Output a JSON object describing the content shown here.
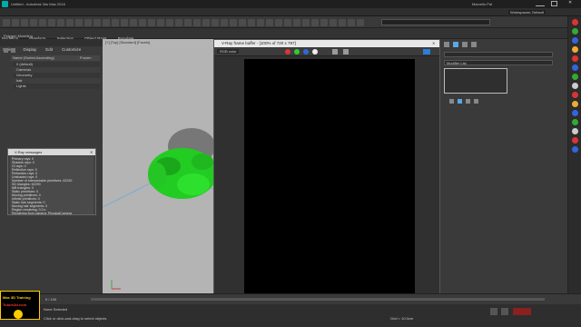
{
  "window": {
    "title": "Untitled - Autodesk 3ds Max 2016",
    "user": "Marcello Pal",
    "workspace": "Workspaces: Default"
  },
  "menu": [
    "File",
    "Edit",
    "Tools",
    "Group",
    "Views",
    "Create",
    "Modifiers",
    "Animation",
    "Graph Editors",
    "Rendering",
    "Civil View",
    "Customize",
    "Scripting",
    "Interactive",
    "Content",
    "Help",
    "Arnold",
    "Substance"
  ],
  "ribbon": {
    "tabs": [
      "Modeling",
      "Freeform",
      "Selection",
      "Object Paint",
      "Populate"
    ],
    "subtitle": "Polygon Modeling"
  },
  "explorer": {
    "tabs": [
      "Select",
      "Display",
      "Edit",
      "Customize"
    ],
    "header": "Name (Sorted Ascending)",
    "col2": "Frozen",
    "rows": [
      "0 (default)",
      "Cameras",
      "Geometry",
      "hair",
      "Lights"
    ]
  },
  "viewport": {
    "label": "[+] [Top] [Standard] [Facets]"
  },
  "framebuffer": {
    "title": "V-Ray frame buffer - [100% of 720 x 797]",
    "channel": "RGB color",
    "status": "Merging light cache passes... done [00:00:01.2]"
  },
  "vray_messages": {
    "title": "V-Ray messages",
    "lines": [
      "Primary rays: 0",
      "Shadow rays: 0",
      "GI rays: 0",
      "Reflection rays: 0",
      "Refraction rays: 0",
      "Unshaded rays: 0",
      "Number of intersectable primitives: 62290",
      "SD triangles: 62290",
      "MB triangles: 0",
      "Static primitives: 0",
      "Moving primitives: 0",
      "Infinite primitives: 0",
      "Static hair segments: 0",
      "Moving hair segments: 0",
      "Region rendering: 0.0 s",
      "Rendering from camera: PhysicalCamera"
    ]
  },
  "modifier": {
    "label": "Modifier List"
  },
  "status": {
    "selection": "None Selected",
    "hint": "Click or click-and-drag to select objects",
    "grid": "Grid = 10.0cm",
    "frame": "0 / 100"
  },
  "logo": {
    "line1": "Max 3D Training",
    "line2": "Tutors3d.com"
  },
  "colors": {
    "accent": "#ffcc00",
    "hair": "#22cc22",
    "panel": "#3a3a3a"
  }
}
